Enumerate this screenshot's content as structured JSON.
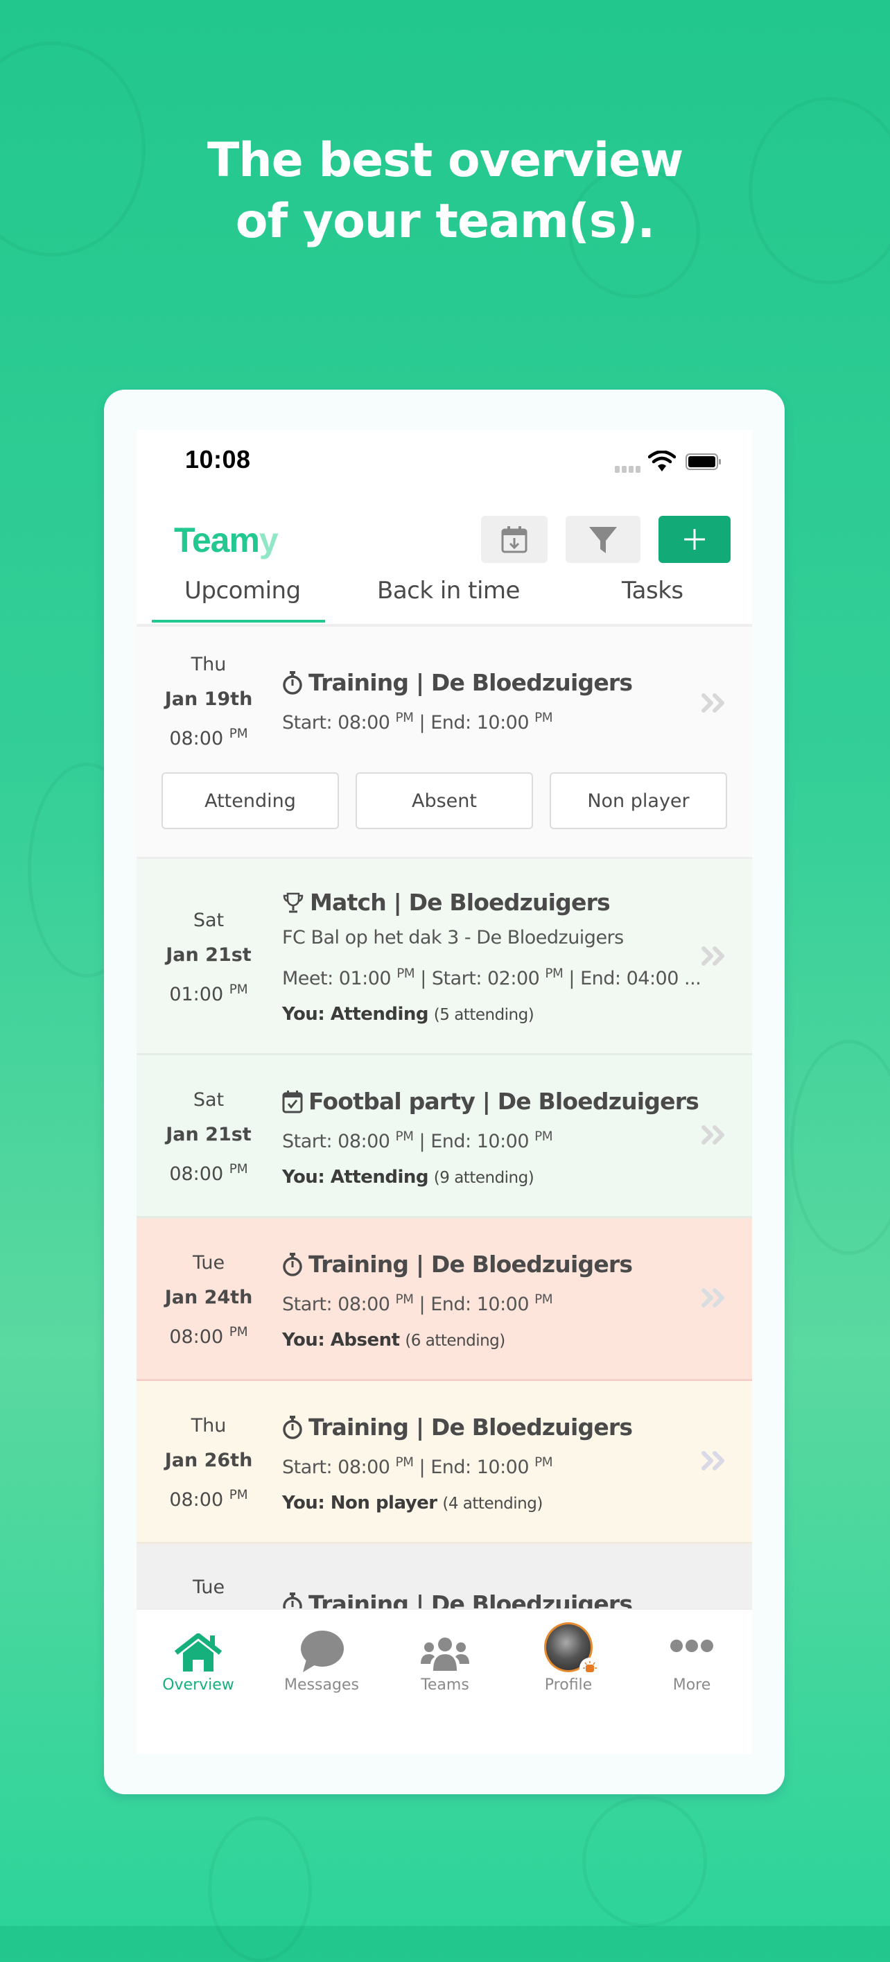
{
  "marketing": {
    "headline_line1": "The best overview",
    "headline_line2": "of your team(s)."
  },
  "status_bar": {
    "time": "10:08"
  },
  "app": {
    "logo_main": "Team",
    "logo_accent": "y",
    "accent_color": "#22c88f",
    "primary_button_color": "#12ab77",
    "toolbar": {
      "calendar_export_icon": "calendar-download-icon",
      "filter_icon": "filter-icon",
      "add_icon": "plus-icon"
    }
  },
  "tabs": [
    {
      "label": "Upcoming",
      "active": true
    },
    {
      "label": "Back in time",
      "active": false
    },
    {
      "label": "Tasks",
      "active": false
    }
  ],
  "events": [
    {
      "dow": "Thu",
      "day": "Jan 19th",
      "time": "08:00",
      "ampm": "PM",
      "icon": "stopwatch-icon",
      "title": "Training | De Bloedzuigers",
      "times": {
        "start_label": "Start: 08:00",
        "start_ampm": "PM",
        "end_label": " | End: 10:00",
        "end_ampm": "PM"
      },
      "rsvp": [
        "Attending",
        "Absent",
        "Non player"
      ],
      "bg": "#fafafa"
    },
    {
      "dow": "Sat",
      "day": "Jan 21st",
      "time": "01:00",
      "ampm": "PM",
      "icon": "trophy-icon",
      "title": "Match | De Bloedzuigers",
      "subtitle": "FC Bal op het dak 3 - De Bloedzuigers",
      "times_text": {
        "meet": "Meet: 01:00",
        "meet_ampm": "PM",
        "start": " | Start: 02:00",
        "start_ampm": "PM",
        "end": " | End: 04:00 ..."
      },
      "you_label": "You: Attending",
      "count": "(5 attending)",
      "bg": "#f2f8f2"
    },
    {
      "dow": "Sat",
      "day": "Jan 21st",
      "time": "08:00",
      "ampm": "PM",
      "icon": "calendar-check-icon",
      "title": "Footbal party | De Bloedzuigers",
      "times": {
        "start_label": "Start: 08:00",
        "start_ampm": "PM",
        "end_label": " | End: 10:00",
        "end_ampm": "PM"
      },
      "you_label": "You: Attending",
      "count": "(9 attending)",
      "bg": "#f0f9f1"
    },
    {
      "dow": "Tue",
      "day": "Jan 24th",
      "time": "08:00",
      "ampm": "PM",
      "icon": "stopwatch-icon",
      "title": "Training | De Bloedzuigers",
      "times": {
        "start_label": "Start: 08:00",
        "start_ampm": "PM",
        "end_label": " | End: 10:00",
        "end_ampm": "PM"
      },
      "you_label": "You: Absent",
      "count": "(6 attending)",
      "bg": "#fee5dc"
    },
    {
      "dow": "Thu",
      "day": "Jan 26th",
      "time": "08:00",
      "ampm": "PM",
      "icon": "stopwatch-icon",
      "title": "Training | De Bloedzuigers",
      "times": {
        "start_label": "Start: 08:00",
        "start_ampm": "PM",
        "end_label": " | End: 10:00",
        "end_ampm": "PM"
      },
      "you_label": "You: Non player",
      "count": "(4 attending)",
      "bg": "#fdf7e9"
    },
    {
      "dow": "Tue",
      "icon": "stopwatch-icon",
      "title": "Training | De Bloedzuigers",
      "bg": "#f0f0f0"
    }
  ],
  "bottom_nav": [
    {
      "label": "Overview",
      "icon": "home-icon",
      "active": true
    },
    {
      "label": "Messages",
      "icon": "chat-bubble-icon",
      "active": false
    },
    {
      "label": "Teams",
      "icon": "group-icon",
      "active": false
    },
    {
      "label": "Profile",
      "icon": "avatar",
      "active": false
    },
    {
      "label": "More",
      "icon": "more-dots-icon",
      "active": false
    }
  ]
}
